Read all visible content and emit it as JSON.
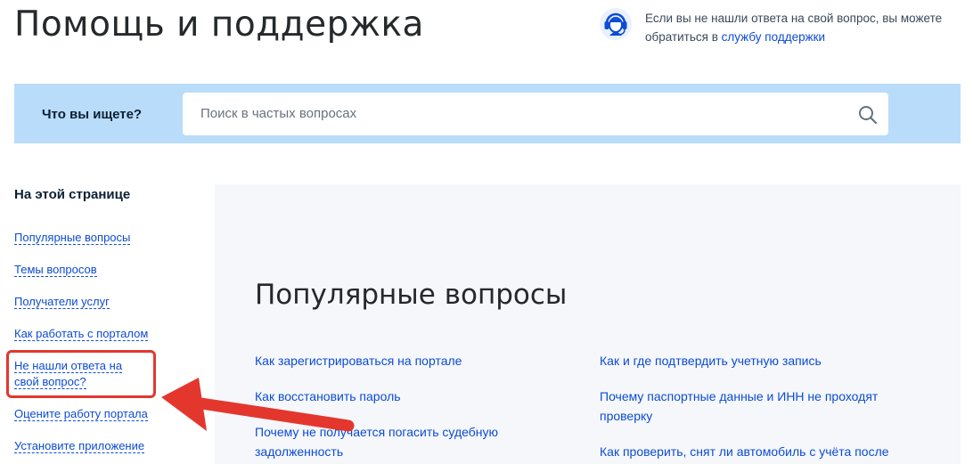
{
  "header": {
    "title": "Помощь и поддержка",
    "support_text": "Если вы не нашли ответа на свой вопрос, вы можете обратиться в",
    "support_link": "службу поддержки",
    "support_icon": "operator-headset-icon"
  },
  "search": {
    "label": "Что вы ищете?",
    "placeholder": "Поиск в частых вопросах",
    "icon": "search-icon"
  },
  "toc": {
    "title": "На этой странице",
    "items": [
      "Популярные вопросы",
      "Темы вопросов",
      "Получатели услуг",
      "Как работать с порталом",
      "Не нашли ответа на свой вопрос?",
      "Оцените работу портала",
      "Установите приложение"
    ]
  },
  "main": {
    "section_title": "Популярные вопросы",
    "questions_left": [
      "Как зарегистрироваться на портале",
      "Как восстановить пароль",
      "Почему не получается погасить судебную задолженность"
    ],
    "questions_right": [
      "Как и где подтвердить учетную запись",
      "Почему паспортные данные и ИНН не проходят проверку",
      "Как проверить, снят ли автомобиль с учёта после"
    ]
  },
  "colors": {
    "accent": "#0d4cd3",
    "search_band": "#b9dcfa",
    "content_bg": "#f5f7fa",
    "annotation_red": "#e3372e"
  }
}
